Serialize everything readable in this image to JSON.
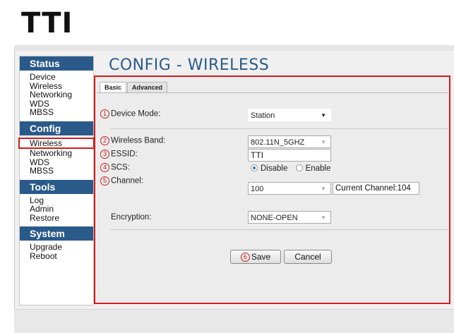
{
  "logo": "TTI",
  "page_title": "CONFIG - WIRELESS",
  "sidebar": {
    "status": {
      "title": "Status",
      "items": [
        "Device",
        "Wireless",
        "Networking",
        "WDS",
        "MBSS"
      ]
    },
    "config": {
      "title": "Config",
      "items": [
        "Wireless",
        "Networking",
        "WDS",
        "MBSS"
      ]
    },
    "tools": {
      "title": "Tools",
      "items": [
        "Log",
        "Admin",
        "Restore"
      ]
    },
    "system": {
      "title": "System",
      "items": [
        "Upgrade",
        "Reboot"
      ]
    }
  },
  "tabs": [
    "Basic",
    "Advanced"
  ],
  "markers": {
    "m1": "1",
    "m2": "2",
    "m3": "3",
    "m4": "4",
    "m5": "5",
    "m6": "6"
  },
  "form": {
    "device_mode": {
      "label": "Device Mode:",
      "value": "Station"
    },
    "wireless_band": {
      "label": "Wireless Band:",
      "value": "802.11N_5GHZ"
    },
    "essid": {
      "label": "ESSID:",
      "value": "TTI"
    },
    "scs": {
      "label": "SCS:",
      "option_disable": "Disable",
      "option_enable": "Enable",
      "selected": "Disable"
    },
    "channel": {
      "label": "Channel:",
      "value": "100",
      "current": "Current Channel:104"
    },
    "encryption": {
      "label": "Encryption:",
      "value": "NONE-OPEN"
    }
  },
  "buttons": {
    "save": "Save",
    "cancel": "Cancel"
  },
  "colors": {
    "accent": "#2a5a8a",
    "highlight": "#d31c1c"
  }
}
